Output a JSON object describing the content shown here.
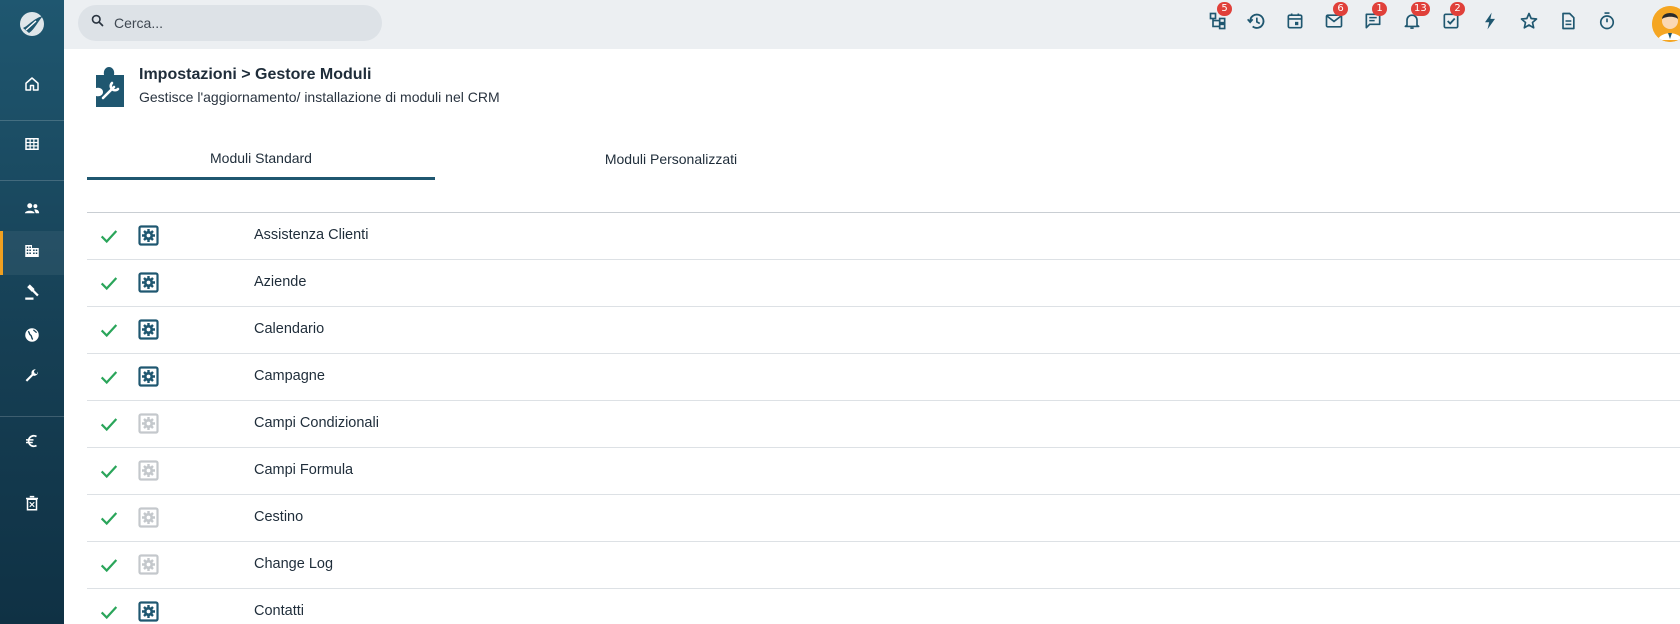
{
  "search": {
    "placeholder": "Cerca..."
  },
  "sidebar": {
    "items": [
      {
        "icon": "home-icon"
      },
      {
        "icon": "grid-icon"
      },
      {
        "icon": "people-icon"
      },
      {
        "icon": "building-icon",
        "active": true
      },
      {
        "icon": "gavel-icon"
      },
      {
        "icon": "globe-icon"
      },
      {
        "icon": "wrench-icon"
      },
      {
        "icon": "euro-icon"
      },
      {
        "icon": "trash-icon"
      }
    ]
  },
  "topbar": {
    "icons": [
      {
        "name": "hierarchy-icon",
        "badge": "5"
      },
      {
        "name": "history-icon",
        "badge": ""
      },
      {
        "name": "calendar-icon",
        "badge": ""
      },
      {
        "name": "mail-icon",
        "badge": "6"
      },
      {
        "name": "chat-icon",
        "badge": "1"
      },
      {
        "name": "bell-icon",
        "badge": "13"
      },
      {
        "name": "task-icon",
        "badge": "2"
      },
      {
        "name": "bolt-icon",
        "badge": ""
      },
      {
        "name": "star-icon",
        "badge": ""
      },
      {
        "name": "document-icon",
        "badge": ""
      },
      {
        "name": "timer-icon",
        "badge": ""
      }
    ]
  },
  "header": {
    "title": "Impostazioni > Gestore Moduli",
    "subtitle": "Gestisce l'aggiornamento/ installazione di moduli nel CRM"
  },
  "tabs": [
    {
      "label": "Moduli Standard",
      "active": true
    },
    {
      "label": "Moduli Personalizzati",
      "active": false
    }
  ],
  "modules": [
    {
      "name": "Assistenza Clienti",
      "enabled": true,
      "configurable": true
    },
    {
      "name": "Aziende",
      "enabled": true,
      "configurable": true
    },
    {
      "name": "Calendario",
      "enabled": true,
      "configurable": true
    },
    {
      "name": "Campagne",
      "enabled": true,
      "configurable": true
    },
    {
      "name": "Campi Condizionali",
      "enabled": true,
      "configurable": false
    },
    {
      "name": "Campi Formula",
      "enabled": true,
      "configurable": false
    },
    {
      "name": "Cestino",
      "enabled": true,
      "configurable": false
    },
    {
      "name": "Change Log",
      "enabled": true,
      "configurable": false
    },
    {
      "name": "Contatti",
      "enabled": true,
      "configurable": true
    }
  ],
  "colors": {
    "check": "#2aa55a",
    "gear_active": "#1f5770",
    "gear_inactive": "#c4c8cc",
    "accent": "#f0a020",
    "badge": "#e0403a"
  }
}
